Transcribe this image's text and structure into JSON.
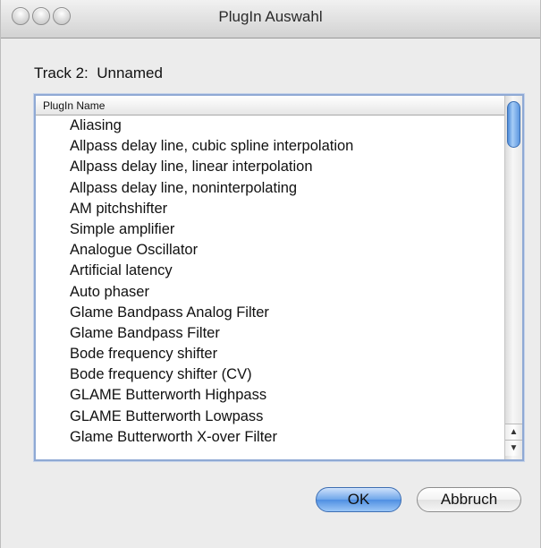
{
  "window": {
    "title": "PlugIn Auswahl"
  },
  "track": {
    "label": "Track 2:  Unnamed"
  },
  "list": {
    "column_header": "PlugIn Name",
    "items": [
      "Aliasing",
      "Allpass delay line, cubic spline interpolation",
      "Allpass delay line, linear interpolation",
      "Allpass delay line, noninterpolating",
      "AM pitchshifter",
      "Simple amplifier",
      "Analogue Oscillator",
      "Artificial latency",
      "Auto phaser",
      "Glame Bandpass Analog Filter",
      "Glame Bandpass Filter",
      "Bode frequency shifter",
      "Bode frequency shifter (CV)",
      "GLAME Butterworth Highpass",
      "GLAME Butterworth Lowpass",
      "Glame Butterworth X-over Filter"
    ],
    "scroll_position": 0.0
  },
  "buttons": {
    "ok_label": "OK",
    "cancel_label": "Abbruch"
  },
  "icons": {
    "close": "close-icon",
    "minimize": "minimize-icon",
    "zoom": "zoom-icon",
    "scroll_up": "arrow-up-icon",
    "scroll_down": "arrow-down-icon"
  },
  "colors": {
    "accent": "#5c97e0",
    "focus_ring": "#8fa9d4"
  }
}
